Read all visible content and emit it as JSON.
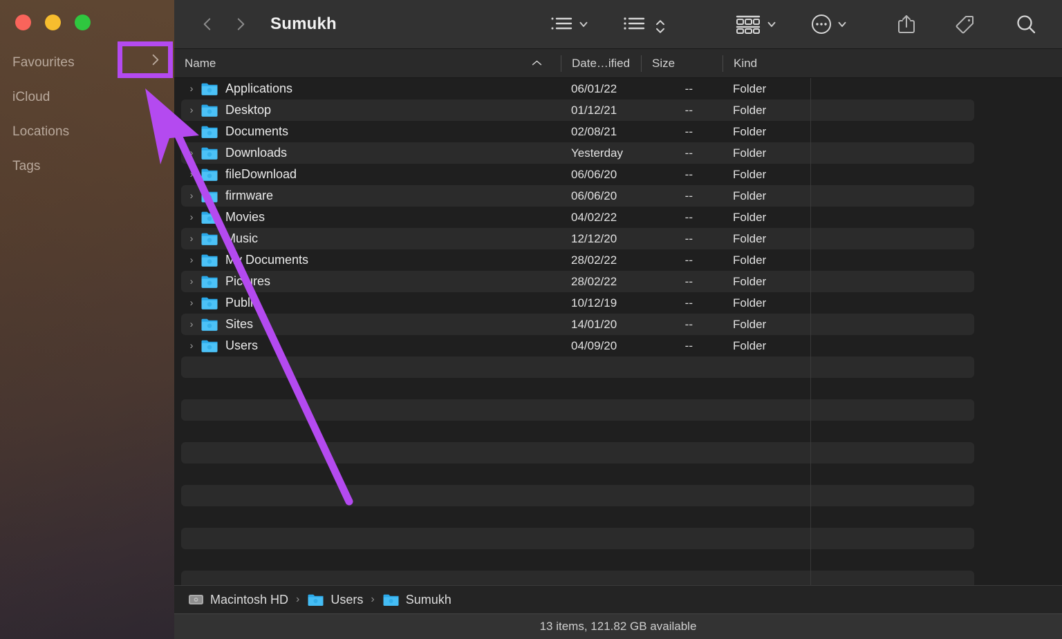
{
  "window": {
    "traffic_lights": [
      {
        "name": "close",
        "color": "#f9645b"
      },
      {
        "name": "minimize",
        "color": "#f7bd2e"
      },
      {
        "name": "maximize",
        "color": "#2fc73f"
      }
    ],
    "title": "Sumukh"
  },
  "sidebar": {
    "sections": [
      {
        "label": "Favourites"
      },
      {
        "label": "iCloud"
      },
      {
        "label": "Locations"
      },
      {
        "label": "Tags"
      }
    ]
  },
  "toolbar": {
    "back_label": "Back",
    "forward_label": "Forward",
    "items": [
      {
        "name": "group-by-icon",
        "label": "Group By"
      },
      {
        "name": "view-as-list-icon",
        "label": "View As List"
      },
      {
        "name": "sort-order-icon",
        "label": "Sort Order"
      },
      {
        "name": "view-options-icon",
        "label": "View Options"
      },
      {
        "name": "action-menu-icon",
        "label": "Action"
      },
      {
        "name": "share-icon",
        "label": "Share"
      },
      {
        "name": "tag-icon",
        "label": "Tags"
      },
      {
        "name": "search-icon",
        "label": "Search"
      }
    ]
  },
  "columns": [
    {
      "key": "name",
      "label": "Name",
      "sort": "ascending"
    },
    {
      "key": "date",
      "label": "Date…ified"
    },
    {
      "key": "size",
      "label": "Size"
    },
    {
      "key": "kind",
      "label": "Kind"
    }
  ],
  "files": [
    {
      "name": "Applications",
      "date": "06/01/22",
      "size": "--",
      "kind": "Folder"
    },
    {
      "name": "Desktop",
      "date": "01/12/21",
      "size": "--",
      "kind": "Folder"
    },
    {
      "name": "Documents",
      "date": "02/08/21",
      "size": "--",
      "kind": "Folder"
    },
    {
      "name": "Downloads",
      "date": "Yesterday",
      "size": "--",
      "kind": "Folder"
    },
    {
      "name": "fileDownload",
      "date": "06/06/20",
      "size": "--",
      "kind": "Folder"
    },
    {
      "name": "firmware",
      "date": "06/06/20",
      "size": "--",
      "kind": "Folder"
    },
    {
      "name": "Movies",
      "date": "04/02/22",
      "size": "--",
      "kind": "Folder"
    },
    {
      "name": "Music",
      "date": "12/12/20",
      "size": "--",
      "kind": "Folder"
    },
    {
      "name": "My Documents",
      "date": "28/02/22",
      "size": "--",
      "kind": "Folder"
    },
    {
      "name": "Pictures",
      "date": "28/02/22",
      "size": "--",
      "kind": "Folder"
    },
    {
      "name": "Public",
      "date": "10/12/19",
      "size": "--",
      "kind": "Folder"
    },
    {
      "name": "Sites",
      "date": "14/01/20",
      "size": "--",
      "kind": "Folder"
    },
    {
      "name": "Users",
      "date": "04/09/20",
      "size": "--",
      "kind": "Folder"
    }
  ],
  "breadcrumb": {
    "separator": "›",
    "items": [
      {
        "label": "Macintosh HD",
        "icon": "hard-drive-icon"
      },
      {
        "label": "Users",
        "icon": "folder-icon"
      },
      {
        "label": "Sumukh",
        "icon": "folder-icon"
      }
    ]
  },
  "status": {
    "text": "13 items, 121.82 GB available"
  },
  "annotations": {
    "highlight_color": "#b44af0",
    "arrow_color": "#b44af0",
    "highlight_target": "sidebar-collapse-chevron"
  }
}
